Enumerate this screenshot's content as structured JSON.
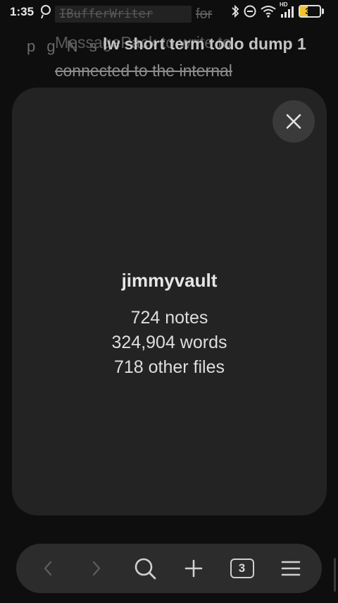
{
  "status_bar": {
    "time": "1:35",
    "battery_level": "39",
    "battery_fraction": 0.39,
    "accent_color": "#f2c230",
    "icons": [
      "dnd-moon-icon",
      "bluetooth-icon",
      "do-not-disturb-icon",
      "wifi-icon",
      "signal-hd-icon",
      "battery-icon"
    ],
    "signal_label": "HD"
  },
  "background_note": {
    "code_text": "IBufferWriter",
    "for_text": "for",
    "messagepack_text": "MessagePack to write to",
    "overlap_text": "p g N s",
    "title": "lw short term todo dump 1",
    "connected_text": "connected to the internal"
  },
  "vault_card": {
    "vault_name": "jimmyvault",
    "stats": {
      "notes": "724 notes",
      "words": "324,904 words",
      "other_files": "718 other files"
    },
    "close_icon": "close-icon"
  },
  "toolbar": {
    "buttons": [
      "back-icon",
      "forward-icon",
      "search-icon",
      "add-icon",
      "tabs-icon",
      "menu-icon"
    ],
    "tabs_count": "3"
  }
}
